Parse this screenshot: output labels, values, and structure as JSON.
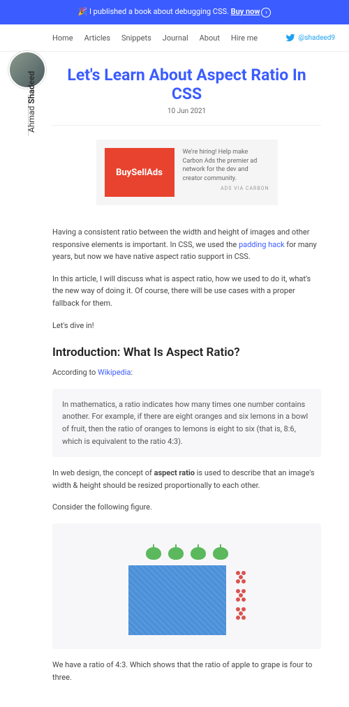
{
  "banner": {
    "prefix": "🎉 I published a book about debugging CSS. ",
    "cta": "Buy now"
  },
  "author": {
    "first": "Ahmad",
    "last": "Shadeed"
  },
  "nav": {
    "items": [
      "Home",
      "Articles",
      "Snippets",
      "Journal",
      "About",
      "Hire me"
    ]
  },
  "twitter": {
    "handle": "@shadeed9"
  },
  "article": {
    "title": "Let's Learn About Aspect Ratio In CSS",
    "date": "10 Jun 2021",
    "ad": {
      "logo": "BuySellAds",
      "text": "We're hiring! Help make Carbon Ads the premier ad network for the dev and creator community.",
      "via": "ADS VIA CARBON"
    },
    "p1_a": "Having a consistent ratio between the width and height of images and other responsive elements is important. In CSS, we used the ",
    "p1_link": "padding hack",
    "p1_b": " for many years, but now we have native aspect ratio support in CSS.",
    "p2": "In this article, I will discuss what is aspect ratio, how we used to do it, what's the new way of doing it. Of course, there will be use cases with a proper fallback for them.",
    "p3": "Let's dive in!",
    "h2": "Introduction: What Is Aspect Ratio?",
    "p4_a": "According to ",
    "p4_link": "Wikipedia",
    "p4_b": ":",
    "quote": "In mathematics, a ratio indicates how many times one number contains another. For example, if there are eight oranges and six lemons in a bowl of fruit, then the ratio of oranges to lemons is eight to six (that is, 8:6, which is equivalent to the ratio 4:3).",
    "p5_a": "In web design, the concept of ",
    "p5_bold": "aspect ratio",
    "p5_b": " is used to describe that an image's width & height should be resized proportionally to each other.",
    "p6": "Consider the following figure.",
    "p7": "We have a ratio of 4:3. Which shows that the ratio of apple to grape is four to three."
  }
}
